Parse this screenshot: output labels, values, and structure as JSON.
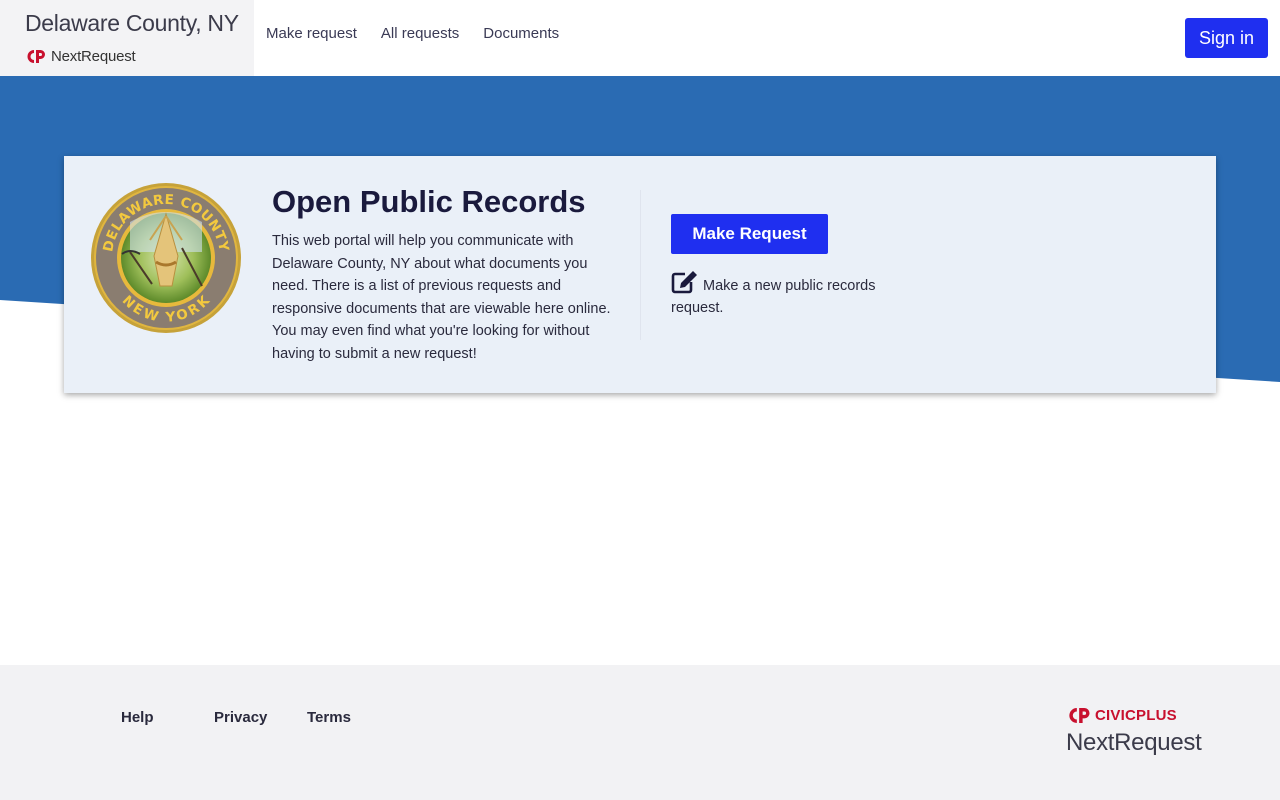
{
  "header": {
    "agency_name": "Delaware County, NY",
    "product_name": "NextRequest",
    "nav": [
      {
        "label": "Make request"
      },
      {
        "label": "All requests"
      },
      {
        "label": "Documents"
      }
    ],
    "sign_in_label": "Sign in"
  },
  "hero": {
    "seal": {
      "top_text": "DELAWARE COUNTY",
      "bottom_text": "NEW YORK"
    },
    "title": "Open Public Records",
    "description": "This web portal will help you communicate with Delaware County, NY about what documents you need. There is a list of previous requests and responsive documents that are viewable here online. You may even find what you're looking for without having to submit a new request!",
    "make_request_label": "Make Request",
    "make_request_hint": "Make a new public records request."
  },
  "footer": {
    "links": [
      {
        "label": "Help"
      },
      {
        "label": "Privacy"
      },
      {
        "label": "Terms"
      }
    ],
    "vendor": "CIVICPLUS",
    "product": "NextRequest"
  },
  "colors": {
    "primary": "#1f2ff0",
    "hero_blue": "#2a6bb3",
    "card_bg": "#eaf0f8",
    "brand_red": "#c8102e"
  }
}
